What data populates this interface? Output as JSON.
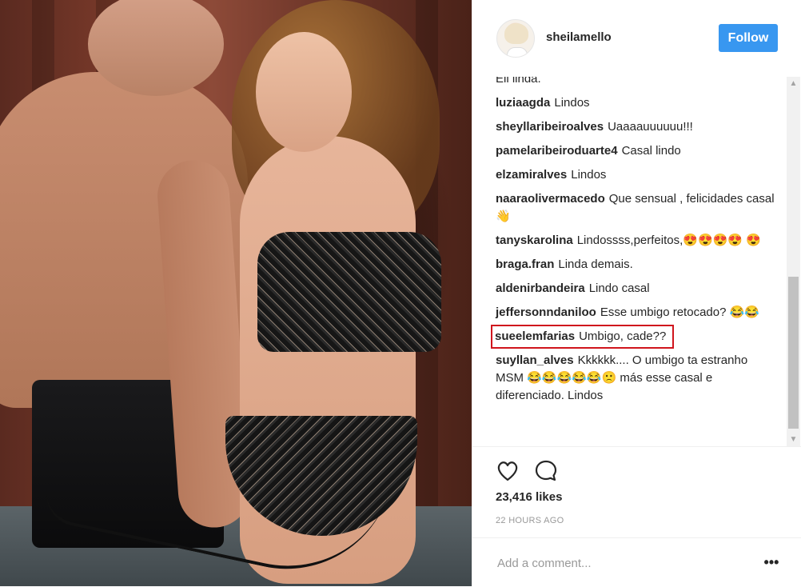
{
  "post": {
    "username": "sheilamello",
    "follow_label": "Follow",
    "likes": "23,416 likes",
    "timestamp": "22 HOURS AGO",
    "add_comment_placeholder": "Add a comment...",
    "more_label": "•••"
  },
  "comments": [
    {
      "user": "",
      "text": "Ell linda."
    },
    {
      "user": "luziaagda",
      "text": "Lindos"
    },
    {
      "user": "sheyllaribeiroalves",
      "text": "Uaaaauuuuuu!!!"
    },
    {
      "user": "pamelaribeiroduarte4",
      "text": "Casal lindo"
    },
    {
      "user": "elzamiralves",
      "text": "Lindos"
    },
    {
      "user": "naaraolivermacedo",
      "text": "Que sensual , felicidades casal 👋"
    },
    {
      "user": "tanyskarolina",
      "text": "Lindossss,perfeitos,😍😍😍😍 😍"
    },
    {
      "user": "braga.fran",
      "text": "Linda demais."
    },
    {
      "user": "aldenirbandeira",
      "text": "Lindo casal"
    },
    {
      "user": "jeffersonndaniloo",
      "text": "Esse umbigo retocado? 😂😂"
    },
    {
      "user": "sueelemfarias",
      "text": "Umbigo, cade??"
    },
    {
      "user": "suyllan_alves",
      "text": "Kkkkkk.... O umbigo ta estranho MSM 😂😂😂😂😂🙁 más esse casal e diferenciado. Lindos"
    }
  ],
  "icons": {
    "like": "heart-icon",
    "comment": "comment-bubble-icon",
    "scroll_up": "scroll-up-arrow",
    "scroll_down": "scroll-down-arrow"
  },
  "colors": {
    "follow_button": "#3897f0",
    "highlight_box": "#d0151d"
  }
}
